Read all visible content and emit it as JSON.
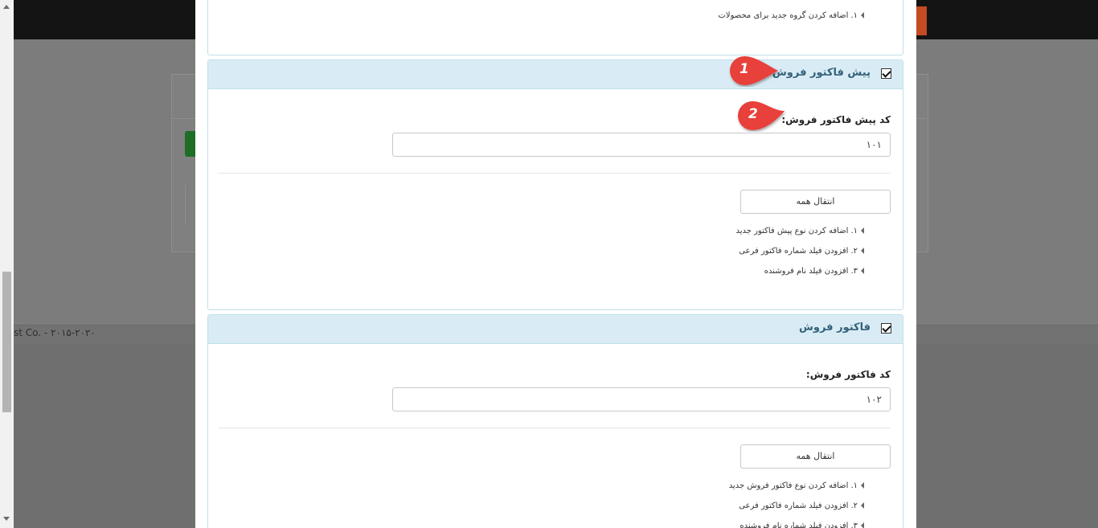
{
  "background": {
    "footer_text": "st Co. - ۲۰۱۵-۲۰۲۰"
  },
  "top_panel": {
    "items": [
      {
        "num": "۱.",
        "text": "اضافه کردن گروه جدید برای محصولات"
      }
    ]
  },
  "proforma_panel": {
    "title": "پیش فاکتور فروش",
    "checked": true,
    "code_label": "کد پیش فاکتور فروش:",
    "code_value": "۱۰۱",
    "transfer_all_label": "انتقال همه",
    "items": [
      {
        "num": "۱.",
        "text": "اضافه کردن نوع پیش فاکتور جدید"
      },
      {
        "num": "۲.",
        "text": "افزودن فیلد شماره فاکتور فرعی"
      },
      {
        "num": "۳.",
        "text": "افزودن فیلد نام فروشنده"
      }
    ]
  },
  "invoice_panel": {
    "title": "فاکتور فروش",
    "checked": true,
    "code_label": "کد فاکتور فروش:",
    "code_value": "۱۰۲",
    "transfer_all_label": "انتقال همه",
    "items": [
      {
        "num": "۱.",
        "text": "اضافه کردن نوع فاکتور فروش جدید"
      },
      {
        "num": "۲.",
        "text": "افزودن فیلد شماره فاکتور فرعی"
      },
      {
        "num": "۳.",
        "text": "افزودن فیلد شماره نام فروشنده"
      }
    ]
  },
  "annotations": [
    {
      "label": "1"
    },
    {
      "label": "2"
    }
  ],
  "colors": {
    "marker": "#e8413b",
    "panel_header": "#d9ecf5",
    "panel_title": "#33617a"
  }
}
